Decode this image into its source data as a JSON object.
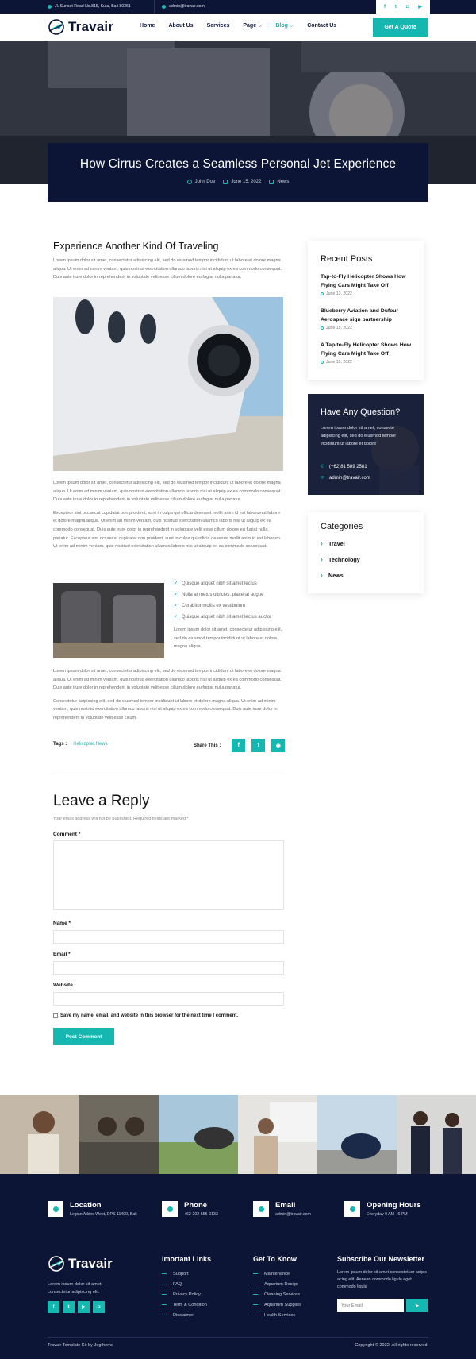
{
  "topbar": {
    "address": "Jl. Sunset Road No.815, Kuta, Bali 80361",
    "email": "admin@travair.com",
    "social": [
      "facebook-icon",
      "twitter-icon",
      "instagram-icon",
      "youtube-icon"
    ]
  },
  "nav": {
    "logo": "Travair",
    "items": [
      "Home",
      "About Us",
      "Services",
      "Page",
      "Blog",
      "Contact Us"
    ],
    "active": "Blog",
    "cta": "Get A Quote"
  },
  "hero": {
    "title": "How Cirrus Creates a Seamless Personal Jet Experience",
    "author": "John Doe",
    "date": "June 15, 2022",
    "category": "News"
  },
  "article": {
    "heading": "Experience Another Kind Of Traveling",
    "p1": "Lorem ipsum dolor sit amet, consectetur adipiscing elit, sed do eiusmod tempor incididunt ut labore et dolore magna aliqua. Ut enim ad minim veniam, quis nostrud exercitation ullamco laboris nisi ut aliquip ex ea commodo consequat. Duis aute irure dolor in reprehenderit in voluptate velit esse cillum dolore eu fugiat nulla pariatur.",
    "p2": "Lorem ipsum dolor sit amet, consectetur adipiscing elit, sed do eiusmod tempor incididunt ut labore et dolore magna aliqua. Ut enim ad minim veniam, quis nostrud exercitation ullamco laboris nisi ut aliquip ex ea commodo consequat. Duis aute irure dolor in reprehenderit in voluptate velit esse cillum dolore eu fugiat nulla pariatur.",
    "p3": "Excepteur sint occaecat cupidatat non proident, sunt in culpa qui officia deserunt mollit anim id est laborumut labore et dolore magna aliqua. Ut enim ad minim veniam, quis nostrud exercitation ullamco laboris nisi ut aliquip ex ea commodo consequat. Duis aute irure dolor in reprehenderit in voluptate velit esse cillum dolore eu fugiat nulla pariatur. Excepteur sint occaecat cupidatat non proident, sunt in culpa qui officia deserunt mollit anim id est laborum. Ut enim ad minim veniam, quis nostrud exercitation ullamco laboris nisi ut aliquip ex ea commodo consequat.",
    "checks": [
      "Quisque aliquet nibh sit amet lectus",
      "Nulla at metus ultricies, placerat augue",
      "Curabitur mollis ex vestibulum",
      "Quisque aliquet nibh sit amet lectus auctor"
    ],
    "p4": "Lorem ipsum dolor sit amet, consectetur adipiscing elit, sed do eiusmod tempor incididunt ut labore et dolore magna aliqua.",
    "p5": "Lorem ipsum dolor sit amet, consectetur adipiscing elit, sed do eiusmod tempor incididunt ut labore et dolore magna aliqua. Ut enim ad minim veniam, quis nostrud exercitation ullamco laboris nisi ut aliquip ex ea commodo consequat. Duis aute irure dolor in reprehenderit in voluptate velit esse cillum dolore eu fugiat nulla pariatur.",
    "p6": "Consectetur adipiscing elit, sed do eiusmod tempor incididunt ut labore et dolore magna aliqua. Ut enim ad minim veniam, quis nostrud exercitation ullamco laboris nisi ut aliquip ex ea commodo consequat. Duis aute irure dolor in reprehenderit in voluptate velit esse cillum.",
    "tags_label": "Tags :",
    "tags": "Helicopter,News",
    "share_label": "Share This :"
  },
  "reply": {
    "heading": "Leave a Reply",
    "note": "Your email address will not be published. Required fields are marked *",
    "comment": "Comment *",
    "name": "Name *",
    "email": "Email *",
    "website": "Website",
    "save": "Save my name, email, and website in this browser for the next time I comment.",
    "submit": "Post Comment"
  },
  "sidebar": {
    "recent_title": "Recent Posts",
    "posts": [
      {
        "title": "Tap-to-Fly Helicopter Shows How Flying Cars Might Take Off",
        "date": "June 13, 2022"
      },
      {
        "title": "Blueberry Aviation and Dufour Aerospace sign partnership",
        "date": "June 15, 2022"
      },
      {
        "title": "A Tap-to-Fly Helicopter Shows How Flying Cars Might Take Off",
        "date": "June 15, 2022"
      }
    ],
    "question_title": "Have Any Question?",
    "question_text": "Lorem ipsum dolor sit amet, consecte adipiscing elit, sed do eiusmod tempor incididunt ut labore et dolore",
    "phone": "(+62)81 589 2581",
    "q_email": "admin@travair.com",
    "categories_title": "Categories",
    "categories": [
      "Travel",
      "Technology",
      "News"
    ]
  },
  "footer": {
    "info": [
      {
        "title": "Location",
        "text": "Legian Atkins West, DPS 11490, Bali"
      },
      {
        "title": "Phone",
        "text": "+62-202-555-0133"
      },
      {
        "title": "Email",
        "text": "admin@travair.com"
      },
      {
        "title": "Opening Hours",
        "text": "Everyday 9 AM - 6 PM"
      }
    ],
    "logo": "Travair",
    "about": "Lorem ipsum dolor sit amet, consectetur adipiscing elit.",
    "links_title": "Imortant Links",
    "links": [
      "Support",
      "FAQ",
      "Privacy Policy",
      "Term & Condition",
      "Disclaimer"
    ],
    "know_title": "Get To Know",
    "know": [
      "Maintenance",
      "Aquarium Design",
      "Cleaning Services",
      "Aquarium Supplies",
      "Health Services"
    ],
    "news_title": "Subscribe Our Newsletter",
    "news_text": "Lorem ipsum dolor sit amet consectetuer adipis acing elit. Aenean commodo ligula eget commodo ligula",
    "news_placeholder": "Your Email",
    "credit": "Travair Template Kit by Jegtheme",
    "copyright": "Copyright © 2022. All rights reserved."
  }
}
